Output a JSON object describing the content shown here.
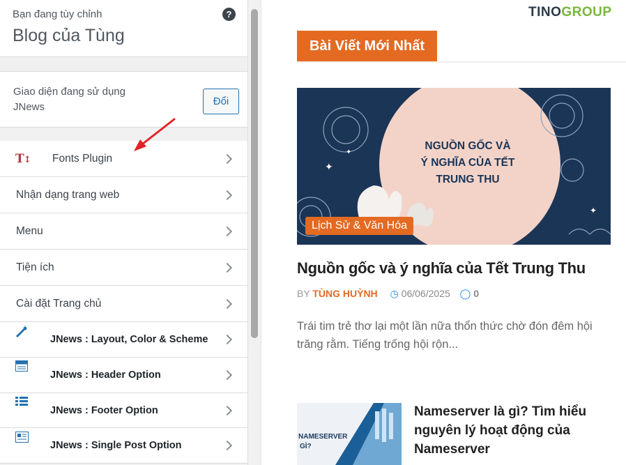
{
  "sidebar": {
    "customizing_label": "Bạn đang tùy chỉnh",
    "site_title": "Blog của Tùng",
    "help_icon": "?",
    "active_theme_label": "Giao diện đang sử dụng",
    "active_theme_name": "JNews",
    "change_button": "Đổi",
    "items": [
      {
        "label": "Fonts Plugin",
        "icon": "font-size-icon"
      },
      {
        "label": "Nhận dạng trang web"
      },
      {
        "label": "Menu"
      },
      {
        "label": "Tiện ích"
      },
      {
        "label": "Cài đặt Trang chủ"
      },
      {
        "label": "JNews : Layout, Color & Scheme",
        "icon": "magic-wand-icon"
      },
      {
        "label": "JNews : Header Option",
        "icon": "header-layout-icon"
      },
      {
        "label": "JNews : Footer Option",
        "icon": "list-layout-icon"
      },
      {
        "label": "JNews : Single Post Option",
        "icon": "single-post-icon"
      }
    ]
  },
  "preview": {
    "logo_part1": "TINO",
    "logo_part2": "GROUP",
    "section_title": "Bài Viết Mới Nhất",
    "featured": {
      "image_text_line1": "NGUỒN GỐC VÀ",
      "image_text_line2": "Ý NGHĨA CỦA TẾT",
      "image_text_line3": "TRUNG THU",
      "category": "Lịch Sử & Văn Hóa",
      "title": "Nguồn gốc và ý nghĩa của Tết Trung Thu",
      "by": "BY",
      "author": "TÙNG HUỲNH",
      "date": "06/06/2025",
      "comments": "0",
      "excerpt": "Trái tim trẻ thơ lại một lần nữa thổn thức chờ đón đêm hội trăng rằm. Tiếng trống hội rộn..."
    },
    "second": {
      "thumb_text_line1": "NAMESERVER",
      "thumb_text_line2": "GÌ?",
      "title": "Nameserver là gì? Tìm hiểu nguyên lý hoạt động của Nameserver"
    }
  },
  "colors": {
    "accent": "#e46a22",
    "wp_blue": "#2271b1",
    "annotation_arrow": "#e02424",
    "feature_bg": "#1b3556"
  }
}
